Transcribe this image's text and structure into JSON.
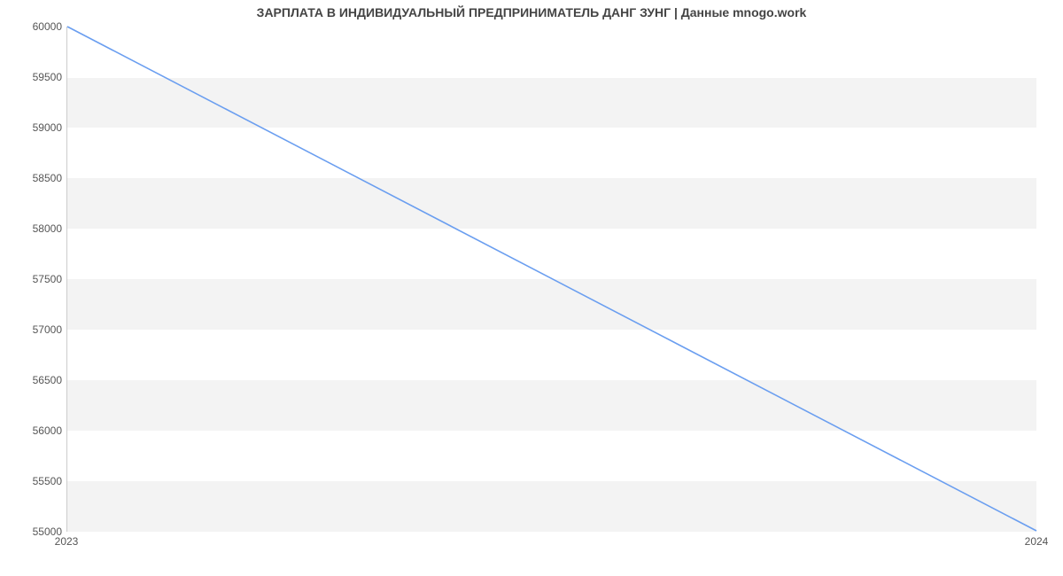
{
  "chart_data": {
    "type": "line",
    "title": "ЗАРПЛАТА В ИНДИВИДУАЛЬНЫЙ ПРЕДПРИНИМАТЕЛЬ ДАНГ ЗУНГ | Данные mnogo.work",
    "xlabel": "",
    "ylabel": "",
    "x": [
      "2023",
      "2024"
    ],
    "values": [
      60000,
      55000
    ],
    "x_ticks": [
      "2023",
      "2024"
    ],
    "y_ticks": [
      55000,
      55500,
      56000,
      56500,
      57000,
      57500,
      58000,
      58500,
      59000,
      59500,
      60000
    ],
    "ylim": [
      55000,
      60000
    ],
    "line_color": "#6a9ef0",
    "band_color": "#f3f3f3"
  }
}
